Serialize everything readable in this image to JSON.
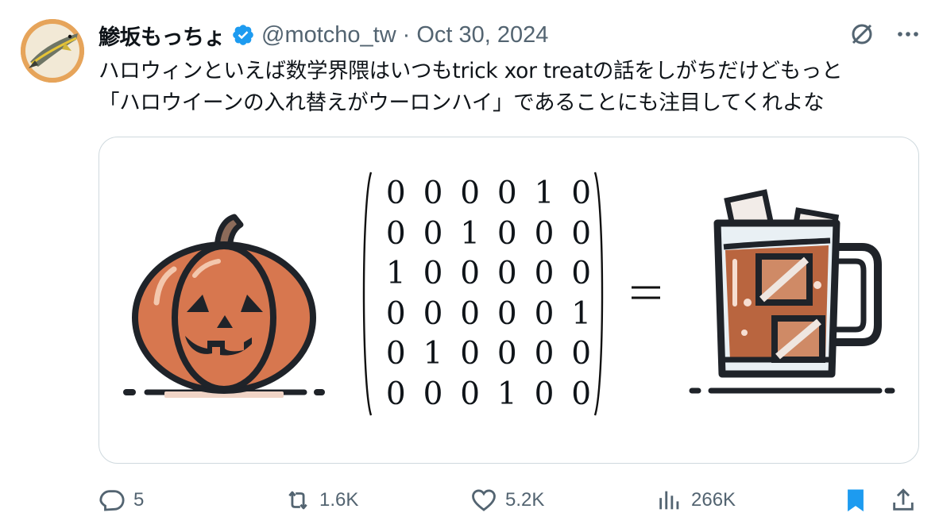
{
  "author": {
    "display_name": "鯵坂もっちょ",
    "handle": "@motcho_tw",
    "separator": "·",
    "date": "Oct 30, 2024",
    "verified": true
  },
  "tweet": {
    "lines": [
      "ハロウィンといえば数学界隈はいつもtrick xor treatの話をしがちだけどもっと",
      "「ハロウイーンの入れ替えがウーロンハイ」であることにも注目してくれよな"
    ]
  },
  "media": {
    "matrix": [
      [
        "0",
        "0",
        "0",
        "0",
        "1",
        "0"
      ],
      [
        "0",
        "0",
        "1",
        "0",
        "0",
        "0"
      ],
      [
        "1",
        "0",
        "0",
        "0",
        "0",
        "0"
      ],
      [
        "0",
        "0",
        "0",
        "0",
        "0",
        "1"
      ],
      [
        "0",
        "1",
        "0",
        "0",
        "0",
        "0"
      ],
      [
        "0",
        "0",
        "0",
        "1",
        "0",
        "0"
      ]
    ],
    "left_image": "pumpkin-illustration",
    "right_image": "oolong-highball-mug-illustration",
    "operator": "equals-sign"
  },
  "actions": {
    "replies": "5",
    "reposts": "1.6K",
    "likes": "5.2K",
    "views": "266K"
  },
  "colors": {
    "text": "#0f1419",
    "secondary": "#536471",
    "verified": "#1d9bf0",
    "bookmark": "#1d9bf0",
    "pumpkin": "#d7774f",
    "drink": "#b9653f",
    "outline": "#1f2329"
  },
  "icons": [
    "verified-badge-icon",
    "grok-icon",
    "more-icon",
    "reply-icon",
    "repost-icon",
    "like-icon",
    "views-icon",
    "bookmark-icon",
    "share-icon"
  ]
}
